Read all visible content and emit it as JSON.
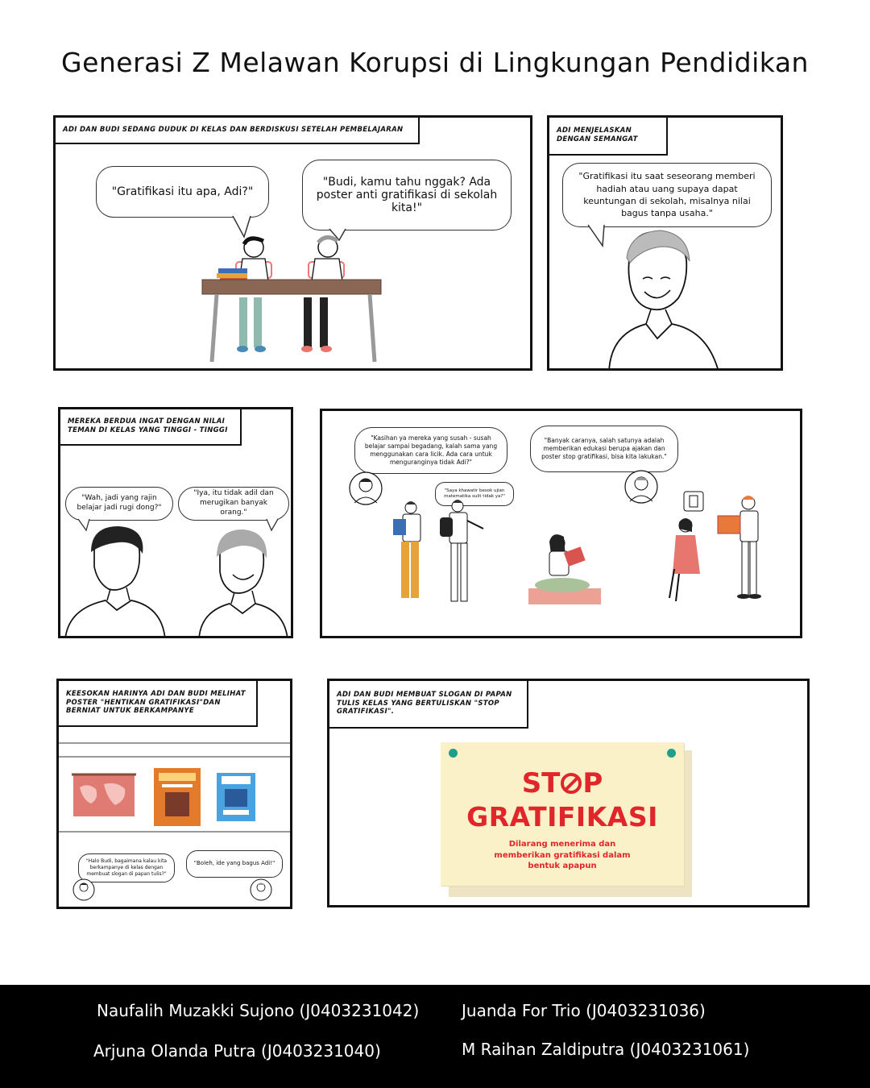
{
  "title": "Generasi Z Melawan Korupsi di Lingkungan Pendidikan",
  "panel1": {
    "caption": "ADI DAN BUDI SEDANG DUDUK DI KELAS DAN BERDISKUSI SETELAH PEMBELAJARAN",
    "bubble_left": "\"Gratifikasi itu apa, Adi?\"",
    "bubble_right": "\"Budi, kamu tahu nggak? Ada poster anti gratifikasi di sekolah kita!\""
  },
  "panel2": {
    "caption": "ADI MENJELASKAN DENGAN SEMANGAT",
    "bubble": "\"Gratifikasi itu saat seseorang memberi hadiah atau uang supaya dapat keuntungan di sekolah, misalnya nilai bagus tanpa usaha.\""
  },
  "panel3": {
    "caption": "MEREKA  BERDUA INGAT DENGAN NILAI TEMAN DI KELAS YANG TINGGI - TINGGI",
    "bubble_left": "\"Wah, jadi yang rajin belajar jadi rugi dong?\"",
    "bubble_right": "\"Iya, itu tidak adil dan merugikan banyak orang.\""
  },
  "panel4": {
    "bubble_left": "\"Kasihan ya mereka yang susah - susah belajar sampai begadang, kalah sama yang menggunakan cara licik. Ada cara untuk menguranginya tidak Adi?\"",
    "bubble_right": "\"Banyak caranya, salah satunya adalah memberikan edukasi berupa ajakan dan poster stop gratifikasi, bisa kita lakukan.\"",
    "bubble_small": "\"Saya khawatir besok ujian matematika sulit tidak ya?\""
  },
  "panel5": {
    "caption": "KEESOKAN HARINYA ADI DAN BUDI MELIHAT POSTER  \"HENTIKAN GRATIFIKASI\"DAN BERNIAT UNTUK BERKAMPANYE",
    "bubble_left": "\"Halo Budi, bagaimana kalau kita berkampanye di kelas dengan membuat slogan di papan tulis?\"",
    "bubble_right": "\"Boleh, ide yang bagus Adi!\""
  },
  "panel6": {
    "caption": "ADI DAN BUDI MEMBUAT SLOGAN DI PAPAN TULIS KELAS YANG BERTULISKAN \"STOP GRATIFIKASI\".",
    "sign_line1_a": "ST",
    "sign_line1_b": "P",
    "sign_line2": "GRATIFIKASI",
    "sign_sub": "Dilarang menerima dan memberikan gratifikasi dalam bentuk apapun"
  },
  "credits": [
    "Naufalih Muzakki Sujono (J0403231042)",
    "Juanda For Trio (J0403231036)",
    "Arjuna Olanda Putra (J0403231040)",
    "M Raihan Zaldiputra (J0403231061)"
  ],
  "colors": {
    "sign_red": "#e0262b",
    "sign_bg": "#fbf1c9",
    "pin": "#1f9e8a",
    "footer": "#000000"
  }
}
